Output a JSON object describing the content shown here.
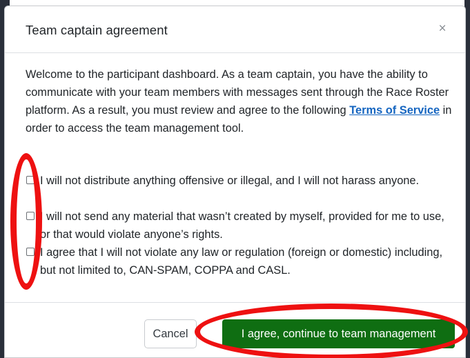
{
  "modal": {
    "title": "Team captain agreement",
    "close_glyph": "×",
    "intro_before_link": "Welcome to the participant dashboard. As a team captain, you have the ability to communicate with your team members with messages sent through the Race Roster platform. As a result, you must review and agree to the following ",
    "intro_link": "Terms of Service",
    "intro_after_link": " in order to access the team management tool.",
    "agreements": [
      {
        "text": "I will not distribute anything offensive or illegal, and I will not harass anyone.",
        "checked": false
      },
      {
        "text": "I will not send any material that wasn’t created by myself, provided for me to use, or that would violate anyone’s rights.",
        "checked": false
      },
      {
        "text": "I agree that I will not violate any law or regulation (foreign or domestic) including, but not limited to, CAN-SPAM, COPPA and CASL.",
        "checked": false
      }
    ],
    "cancel_label": "Cancel",
    "agree_label": "I agree, continue to team management"
  },
  "colors": {
    "agree_button": "#0f6e12",
    "link": "#1565c0",
    "annotation": "#ee1111"
  },
  "icons": {
    "close": "close-icon"
  }
}
